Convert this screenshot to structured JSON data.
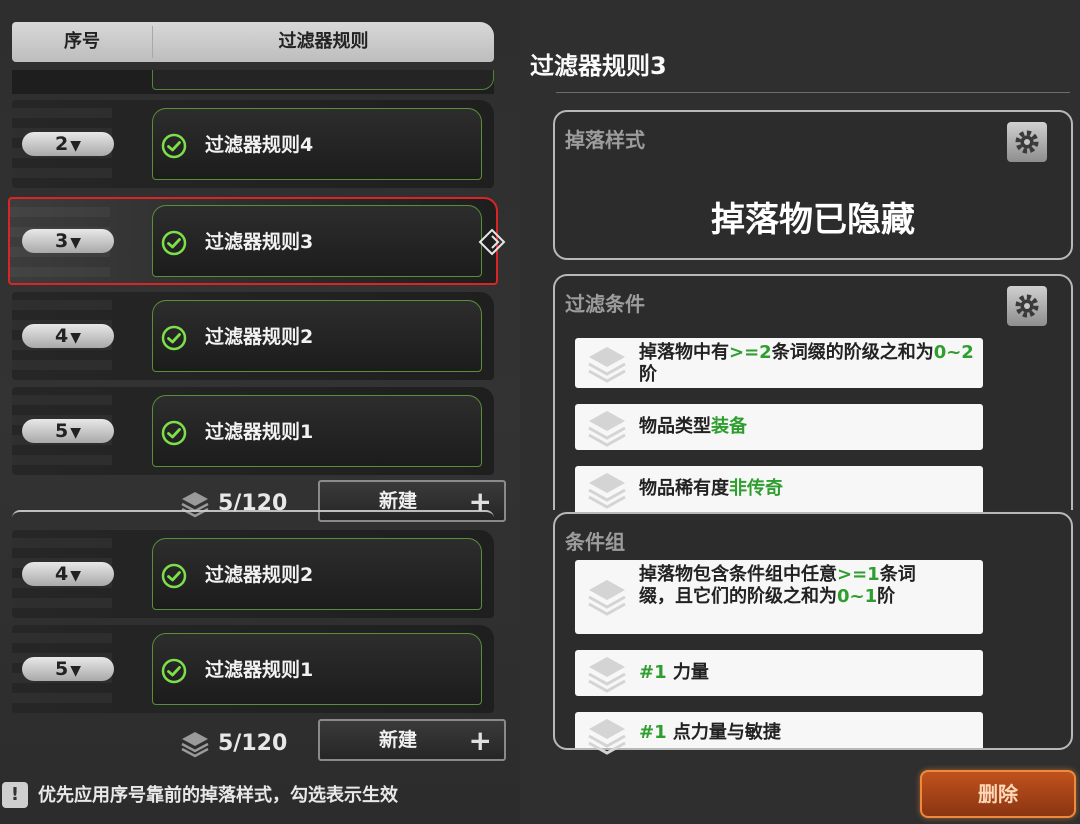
{
  "list": {
    "header_index": "序号",
    "header_rule": "过滤器规则",
    "rows_top": [
      {
        "index": "2",
        "name": "过滤器规则4",
        "selected": false
      },
      {
        "index": "3",
        "name": "过滤器规则3",
        "selected": true
      },
      {
        "index": "4",
        "name": "过滤器规则2",
        "selected": false
      },
      {
        "index": "5",
        "name": "过滤器规则1",
        "selected": false
      }
    ],
    "rows_bottom": [
      {
        "index": "4",
        "name": "过滤器规则2"
      },
      {
        "index": "5",
        "name": "过滤器规则1"
      }
    ],
    "count": "5/120",
    "new_button": "新建",
    "dropdown_arrow": "▼"
  },
  "tip": {
    "icon": "!",
    "text": "优先应用序号靠前的掉落样式，勾选表示生效"
  },
  "delete_button": "删除",
  "detail": {
    "title": "过滤器规则3",
    "drop_style": {
      "label": "掉落样式",
      "value": "掉落物已隐藏"
    },
    "filter_conditions": {
      "label": "过滤条件",
      "items": [
        {
          "parts": [
            {
              "t": "掉落物中有",
              "g": false
            },
            {
              "t": ">=2",
              "g": true
            },
            {
              "t": "条词缀的阶级之和为",
              "g": false
            },
            {
              "t": "0~2",
              "g": true
            },
            {
              "t": "阶",
              "g": false
            }
          ]
        },
        {
          "parts": [
            {
              "t": "物品类型",
              "g": false
            },
            {
              "t": "装备",
              "g": true
            }
          ]
        },
        {
          "parts": [
            {
              "t": "物品稀有度",
              "g": false
            },
            {
              "t": "非传奇",
              "g": true
            }
          ]
        }
      ]
    },
    "condition_group": {
      "label": "条件组",
      "items": [
        {
          "parts": [
            {
              "t": "掉落物包含条件组中任意",
              "g": false
            },
            {
              "t": ">=1",
              "g": true
            },
            {
              "t": "条词缀，且它们的阶级之和为",
              "g": false
            },
            {
              "t": "0~1",
              "g": true
            },
            {
              "t": "阶",
              "g": false
            }
          ]
        },
        {
          "parts": [
            {
              "t": "#1",
              "g": true
            },
            {
              "t": " 力量",
              "g": false
            }
          ]
        },
        {
          "parts": [
            {
              "t": "#1",
              "g": true
            },
            {
              "t": " 点力量与敏捷",
              "g": false
            }
          ]
        }
      ]
    }
  },
  "colors": {
    "accent_green": "#2e9e2e",
    "selection_red": "#d92525",
    "delete_orange": "#f08a3a"
  }
}
